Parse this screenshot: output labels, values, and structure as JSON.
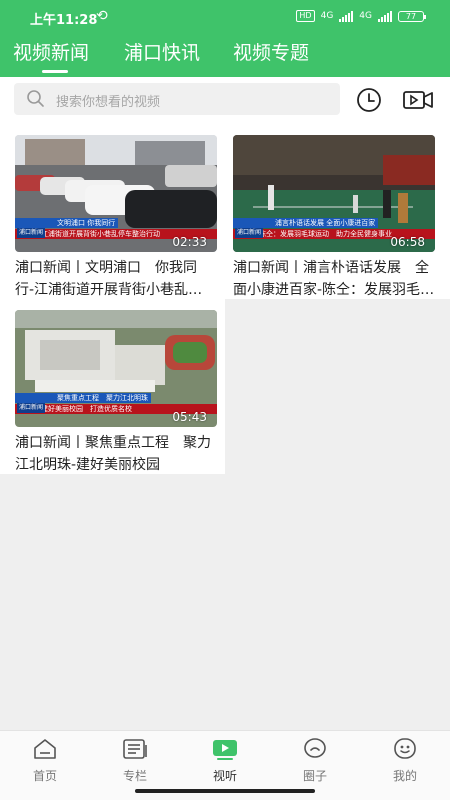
{
  "status_bar": {
    "time": "上午11:28",
    "hd": "HD",
    "net1": "4G",
    "net2": "4G",
    "battery": "77"
  },
  "tabs": [
    {
      "label": "视频新闻",
      "active": true
    },
    {
      "label": "浦口快讯",
      "active": false
    },
    {
      "label": "视频专题",
      "active": false
    }
  ],
  "search": {
    "placeholder": "搜索你想看的视频"
  },
  "videos": [
    {
      "title": "浦口新闻丨文明浦口　你我同行-江浦街道开展背街小巷乱停车整治行动",
      "duration": "02:33",
      "caption_top": "文明浦口 你我同行",
      "caption_bottom": "江浦街道开展背街小巷乱停车整治行动",
      "logo": "浦口新闻"
    },
    {
      "title": "浦口新闻丨浦言朴语话发展　全面小康进百家-陈仝：发展羽毛球运动",
      "duration": "06:58",
      "caption_top": "浦言朴语话发展 全面小康进百家",
      "caption_bottom": "陈仝：发展羽毛球运动　助力全民健身事业",
      "logo": "浦口新闻"
    },
    {
      "title": "浦口新闻丨聚焦重点工程　聚力江北明珠-建好美丽校园",
      "duration": "05:43",
      "caption_top": "聚焦重点工程　聚力江北明珠",
      "caption_bottom": "建好美丽校园　打造优质名校",
      "logo": "浦口新闻"
    }
  ],
  "nav": [
    {
      "label": "首页",
      "icon": "home-icon",
      "active": false
    },
    {
      "label": "专栏",
      "icon": "column-icon",
      "active": false
    },
    {
      "label": "视听",
      "icon": "video-play-icon",
      "active": true
    },
    {
      "label": "圈子",
      "icon": "chat-circle-icon",
      "active": false
    },
    {
      "label": "我的",
      "icon": "profile-icon",
      "active": false
    }
  ],
  "colors": {
    "brand_green": "#3fc36a",
    "caption_blue": "#1a57b8",
    "caption_red": "#b8131c"
  }
}
